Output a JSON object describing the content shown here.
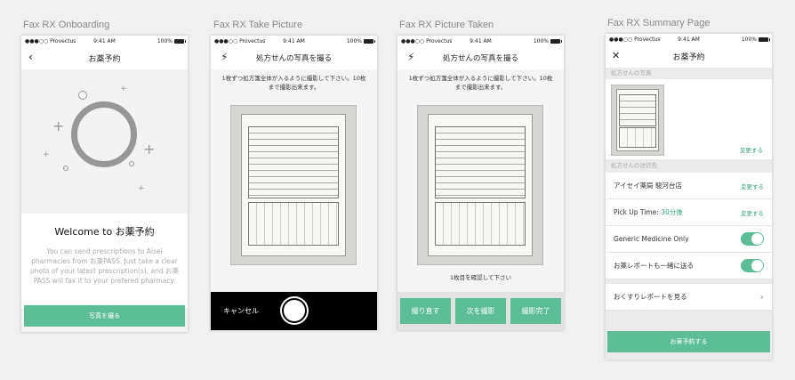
{
  "artboards": [
    "Fax RX Onboarding",
    "Fax RX Take Picture",
    "Fax RX Picture Taken",
    "Fax RX Summary Page"
  ],
  "status": {
    "carrier": "●●●○○ Provectus",
    "time": "9:41 AM",
    "battery": "100%"
  },
  "onboarding": {
    "title": "お薬予約",
    "welcome": "Welcome to お薬予約",
    "description": "You can send prescriptions to Aisei pharmacies from お薬PASS. Just take a clear photo of your latest prescription(s), and お薬PASS will fax it to your prefered pharmacy.",
    "cta": "写真を撮る"
  },
  "take_picture": {
    "title": "処方せんの写真を撮る",
    "instruction": "1枚ずつ処方箋全体が入るように撮影して下さい。10枚まで撮影出来ます。",
    "cancel": "キャンセル"
  },
  "picture_taken": {
    "title": "処方せんの写真を撮る",
    "instruction": "1枚ずつ処方箋全体が入るように撮影して下さい。10枚まで撮影出来ます。",
    "confirm": "1枚目を確認して下さい",
    "retake": "撮り直す",
    "next": "次を撮影",
    "done": "撮影完了"
  },
  "summary": {
    "title": "お薬予約",
    "photo_section": "処方せんの写真",
    "change": "変更する",
    "destination_section": "処方せんの送信先",
    "pharmacy": "アイセイ薬局 駿河台店",
    "pickup_label": "Pick Up Time:",
    "pickup_value": "30分後",
    "generic": "Generic Medicine Only",
    "report_send": "お薬レポートも一緒に送る",
    "report_view": "おくすりレポートを見る",
    "cta": "お薬予約する"
  },
  "colors": {
    "accent": "#5cbd96",
    "link": "#3a9e7c"
  }
}
